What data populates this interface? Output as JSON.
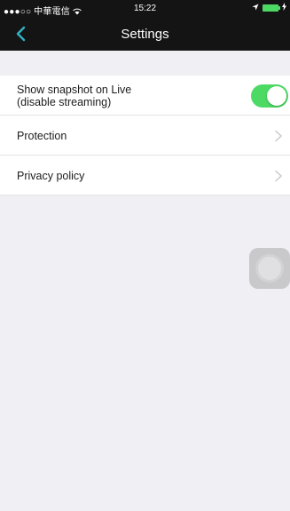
{
  "status_bar": {
    "carrier": "●●●○○ 中華電信",
    "wifi_icon": "wifi-icon",
    "time": "15:22",
    "location_icon": "location-arrow-icon",
    "battery_icon": "battery-icon",
    "battery_color": "#4cd964"
  },
  "navbar": {
    "back_icon": "chevron-left-icon",
    "back_color": "#2fb3c6",
    "title": "Settings",
    "background": "#141414"
  },
  "settings": {
    "snapshot": {
      "label_line1": "Show snapshot on Live",
      "label_line2": "(disable streaming)",
      "enabled": true,
      "toggle_color": "#4cd964"
    },
    "protection": {
      "label": "Protection"
    },
    "privacy": {
      "label": "Privacy policy"
    }
  }
}
